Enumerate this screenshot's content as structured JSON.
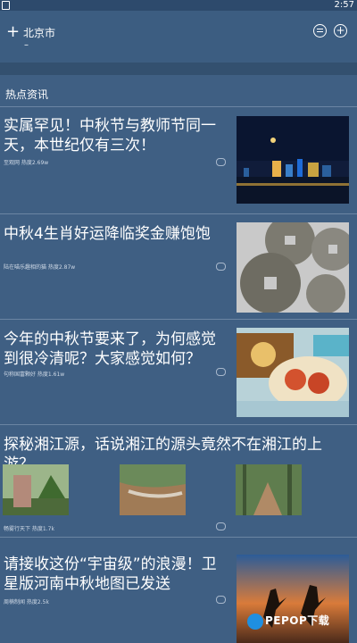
{
  "status_bar": {
    "time": "2:57"
  },
  "header": {
    "add_symbol": "+",
    "city": "北京市",
    "dash": "–",
    "comment_icon": "comment-icon",
    "add_icon": "add-circle-icon"
  },
  "section": {
    "title": "热点资讯"
  },
  "news": [
    {
      "title": "实属罕见！中秋节与教师节同一天，本世纪仅有三次！",
      "meta": "至观网 热度2.69w",
      "thumb": "night-city-moon"
    },
    {
      "title": "中秋4生肖好运降临奖金赚饱饱",
      "meta": "陆在喵乐趣相的猫 热度2.87w",
      "thumb": "ancient-coins"
    },
    {
      "title": "今年的中秋节要来了，为何感觉到很冷清呢？大家感觉如何？",
      "meta": "句称国富颗好 热度1.61w",
      "thumb": "mooncakes-crabs"
    },
    {
      "title": "探秘湘江源，话说湘江的源头竟然不在湘江的上游？",
      "meta": "畅雾行天下 热度1.7k",
      "thumbs": [
        "stele-landscape",
        "river-rocks",
        "forest-path"
      ]
    },
    {
      "title": "请接收这份“宇宙级”的浪漫！卫星版河南中秋地图已发送",
      "meta": "周楠制闻 热度2.5k",
      "thumb": "sunset-silhouettes"
    }
  ],
  "watermark": {
    "text": "PEPOP下载"
  }
}
